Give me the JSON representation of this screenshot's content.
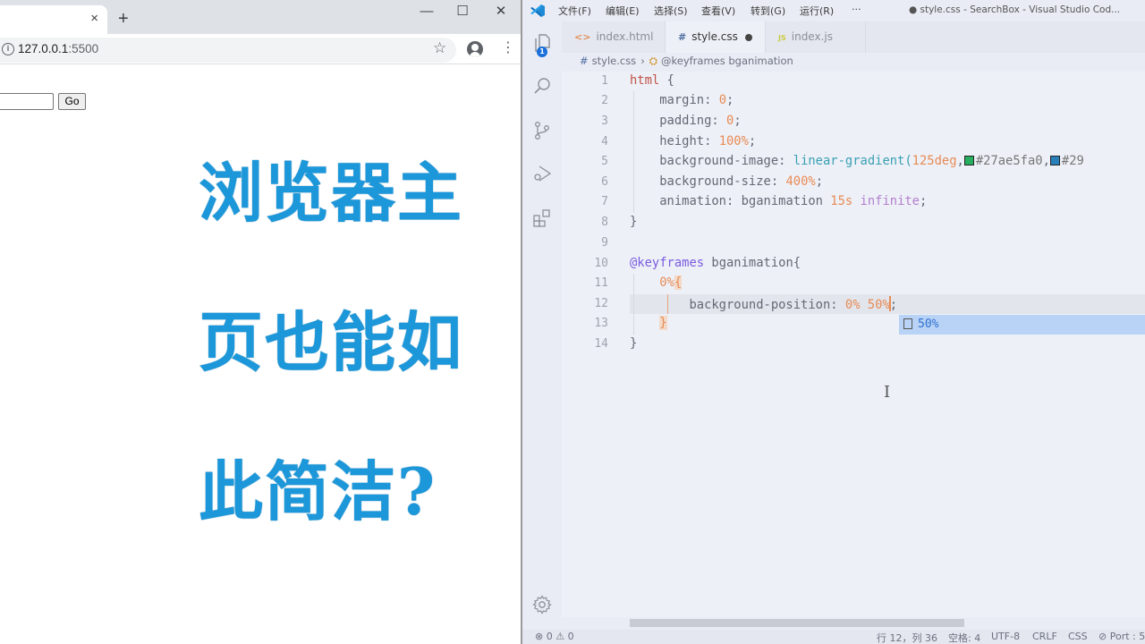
{
  "browser": {
    "tab_close": "×",
    "new_tab": "+",
    "window_controls": {
      "minimize": "—",
      "maximize": "☐",
      "close": "✕"
    },
    "url_host": "127.0.0.1",
    "url_port": ":5500",
    "star_icon": "☆",
    "menu_icon": "⋮",
    "page": {
      "search_input_value": "",
      "go_button": "Go"
    },
    "overlay_lines": [
      "浏览器主",
      "页也能如",
      "此简洁?"
    ]
  },
  "vscode": {
    "menu": [
      "文件(F)",
      "编辑(E)",
      "选择(S)",
      "查看(V)",
      "转到(G)",
      "运行(R)",
      "···"
    ],
    "window_title": "● style.css - SearchBox - Visual Studio Cod...",
    "explorer_badge": "1",
    "tabs": [
      {
        "label": "index.html",
        "icon": "<>",
        "icon_color": "#e37933",
        "active": false
      },
      {
        "label": "style.css",
        "icon": "#",
        "icon_color": "#4f6ea0",
        "active": true,
        "dirty": true
      },
      {
        "label": "index.js",
        "icon": "JS",
        "icon_color": "#cbcb41",
        "active": false
      }
    ],
    "breadcrumb": {
      "file": "style.css",
      "symbol": "@keyframes bganimation"
    },
    "line_numbers": [
      "1",
      "2",
      "3",
      "4",
      "5",
      "6",
      "7",
      "8",
      "9",
      "10",
      "11",
      "12",
      "13",
      "14"
    ],
    "code": {
      "l1_sel": "html",
      "l1_rest": " {",
      "l2_prop": "margin: ",
      "l2_val": "0",
      "l2_end": ";",
      "l3_prop": "padding: ",
      "l3_val": "0",
      "l3_end": ";",
      "l4_prop": "height: ",
      "l4_val": "100%",
      "l4_end": ";",
      "l5_prop": "background-image: ",
      "l5_fn": "linear-gradient(",
      "l5_deg": "125deg",
      "l5_comma": ",",
      "l5_hex1": "#27ae5fa0",
      "l5_hex2": "#29",
      "l5_swatch1": "#27ae5f",
      "l5_swatch2": "#2980b9",
      "l6_prop": "background-size: ",
      "l6_val": "400%",
      "l6_end": ";",
      "l7_prop": "animation: bganimation ",
      "l7_dur": "15s",
      "l7_inf": "infinite",
      "l7_end": ";",
      "l8": "}",
      "l10_at": "@keyframes",
      "l10_rest": " bganimation{",
      "l11_val": "0%",
      "l11_brace": "{",
      "l12_prop": "background-position: ",
      "l12_val": "0% 50%",
      "l12_end": ";",
      "l13": "}",
      "l14": "}"
    },
    "suggestion": "50%",
    "status": {
      "errors": "0",
      "warnings": "0",
      "position": "行 12，列 36",
      "indent": "空格: 4",
      "encoding": "UTF-8",
      "eol": "CRLF",
      "language": "CSS",
      "port": "Port : 5"
    }
  }
}
